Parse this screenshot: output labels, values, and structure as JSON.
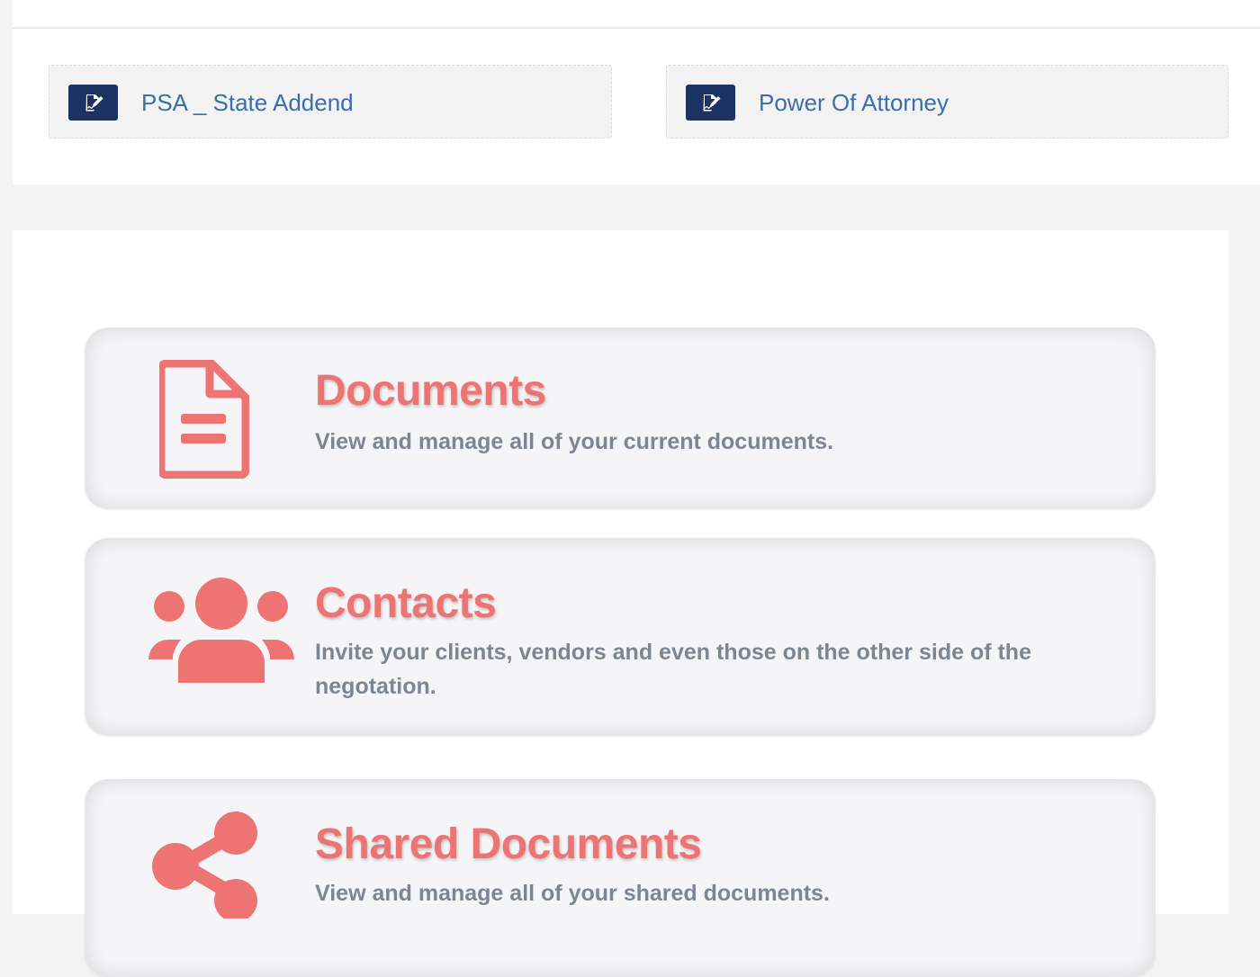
{
  "recent_documents": [
    {
      "label": "PSA _ State Addend",
      "icon": "signed-document-icon"
    },
    {
      "label": "Power Of Attorney",
      "icon": "signed-document-icon"
    }
  ],
  "cards": [
    {
      "title": "Documents",
      "description": "View and manage all of your current documents.",
      "icon": "document-icon"
    },
    {
      "title": "Contacts",
      "description": "Invite your clients, vendors and even those on the other side of the negotation.",
      "icon": "users-icon"
    },
    {
      "title": "Shared Documents",
      "description": "View and manage all of your shared documents.",
      "icon": "share-icon"
    }
  ],
  "colors": {
    "accent": "#ee7474",
    "navy": "#1b3263",
    "link": "#3b6ea8",
    "muted_text": "#7d8593"
  }
}
